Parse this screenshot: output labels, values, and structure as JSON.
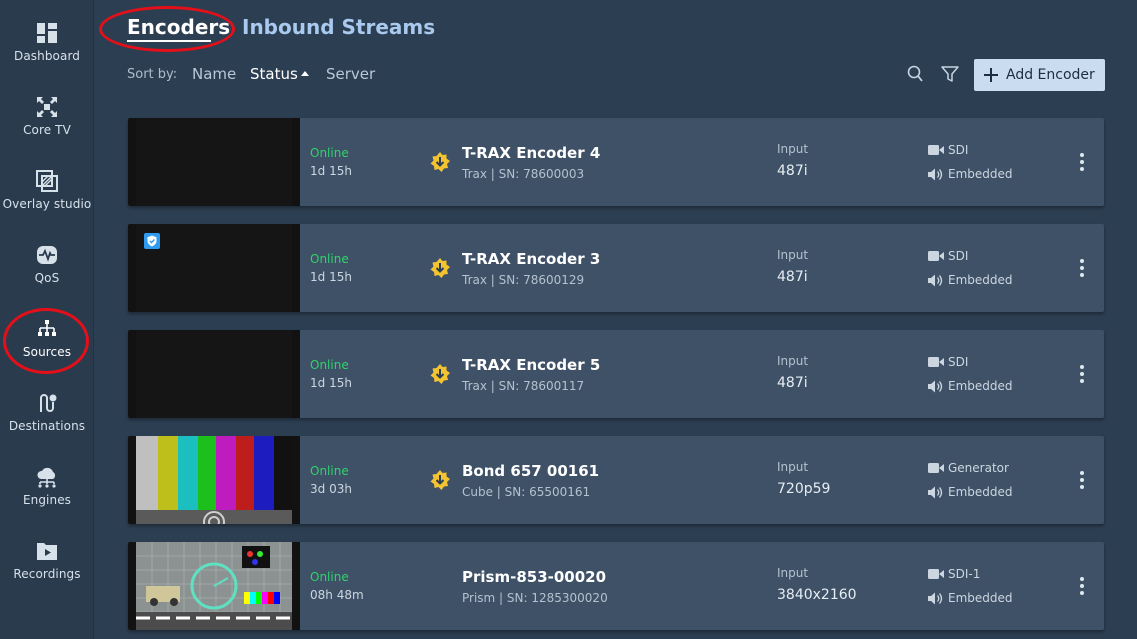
{
  "sidebar": {
    "items": [
      {
        "label": "Dashboard",
        "icon": "dashboard-icon"
      },
      {
        "label": "Core TV",
        "icon": "core-tv-icon"
      },
      {
        "label": "Overlay studio",
        "icon": "overlay-studio-icon"
      },
      {
        "label": "QoS",
        "icon": "qos-icon"
      },
      {
        "label": "Sources",
        "icon": "sources-icon"
      },
      {
        "label": "Destinations",
        "icon": "destinations-icon"
      },
      {
        "label": "Engines",
        "icon": "engines-icon"
      },
      {
        "label": "Recordings",
        "icon": "recordings-icon"
      }
    ]
  },
  "header": {
    "tabs": [
      {
        "label": "Encoders"
      },
      {
        "label": "Inbound Streams"
      }
    ]
  },
  "sort": {
    "label": "Sort by:",
    "options": [
      "Name",
      "Status",
      "Server"
    ],
    "active": "Status"
  },
  "toolbar": {
    "add_label": "Add Encoder"
  },
  "colors": {
    "accent_circle": "#e3101a",
    "online": "#2fd36a",
    "encoder_icon": "#f4c430"
  },
  "encoders": [
    {
      "status": "Online",
      "uptime": "1d 15h",
      "name": "T-RAX Encoder 4",
      "sub": "Trax | SN: 78600003",
      "input_label": "Input",
      "input": "487i",
      "video": "SDI",
      "audio": "Embedded"
    },
    {
      "status": "Online",
      "uptime": "1d 15h",
      "name": "T-RAX Encoder 3",
      "sub": "Trax | SN: 78600129",
      "input_label": "Input",
      "input": "487i",
      "video": "SDI",
      "audio": "Embedded"
    },
    {
      "status": "Online",
      "uptime": "1d 15h",
      "name": "T-RAX Encoder 5",
      "sub": "Trax | SN: 78600117",
      "input_label": "Input",
      "input": "487i",
      "video": "SDI",
      "audio": "Embedded"
    },
    {
      "status": "Online",
      "uptime": "3d 03h",
      "name": "Bond 657 00161",
      "sub": "Cube | SN: 65500161",
      "input_label": "Input",
      "input": "720p59",
      "video": "Generator",
      "audio": "Embedded"
    },
    {
      "status": "Online",
      "uptime": "08h 48m",
      "name": "Prism-853-00020",
      "sub": "Prism | SN: 1285300020",
      "input_label": "Input",
      "input": "3840x2160",
      "video": "SDI-1",
      "audio": "Embedded"
    }
  ]
}
